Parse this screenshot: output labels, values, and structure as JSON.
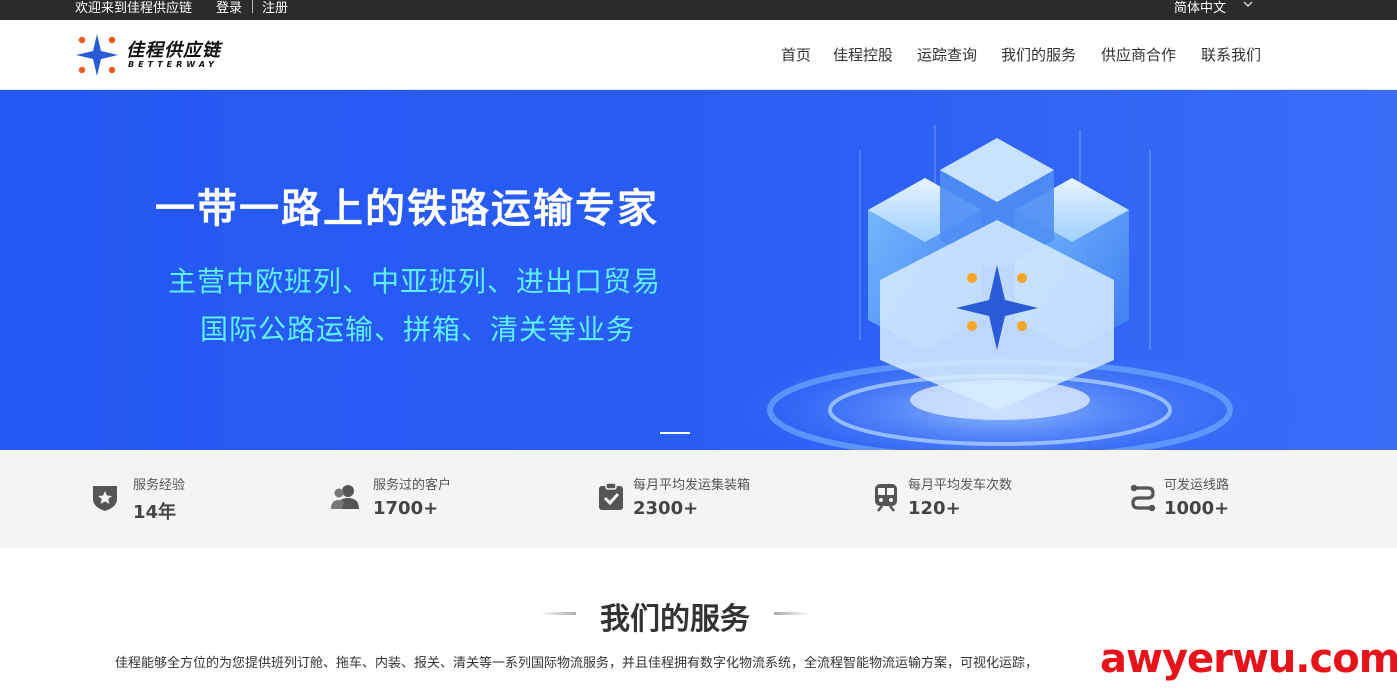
{
  "topbar": {
    "welcome": "欢迎来到佳程供应链",
    "login": "登录",
    "register": "注册",
    "language": "简体中文"
  },
  "header": {
    "logo_title": "佳程供应链",
    "logo_sub": "BETTERWAY",
    "nav": [
      "首页",
      "佳程控股",
      "运踪查询",
      "我们的服务",
      "供应商合作",
      "联系我们"
    ]
  },
  "hero": {
    "title": "一带一路上的铁路运输专家",
    "line1": "主营中欧班列、中亚班列、进出口贸易",
    "line2": "国际公路运输、拼箱、清关等业务"
  },
  "stats": [
    {
      "label": "服务经验",
      "value": "14年",
      "icon": "shield-star-icon"
    },
    {
      "label": "服务过的客户",
      "value": "1700+",
      "icon": "users-icon"
    },
    {
      "label": "每月平均发运集装箱",
      "value": "2300+",
      "icon": "clipboard-check-icon"
    },
    {
      "label": "每月平均发车次数",
      "value": "120+",
      "icon": "train-icon"
    },
    {
      "label": "可发运线路",
      "value": "1000+",
      "icon": "route-icon"
    }
  ],
  "services": {
    "title": "我们的服务",
    "description": "佳程能够全方位的为您提供班列订舱、拖车、内装、报关、清关等一系列国际物流服务，并且佳程拥有数字化物流系统，全流程智能物流运输方案，可视化运踪，"
  },
  "watermark": "awyerwu.com",
  "colors": {
    "hero_bg": "#2458f2",
    "hero_accent": "#5ef0f8",
    "topbar_bg": "#2b2b2b",
    "watermark": "#e8131a"
  }
}
